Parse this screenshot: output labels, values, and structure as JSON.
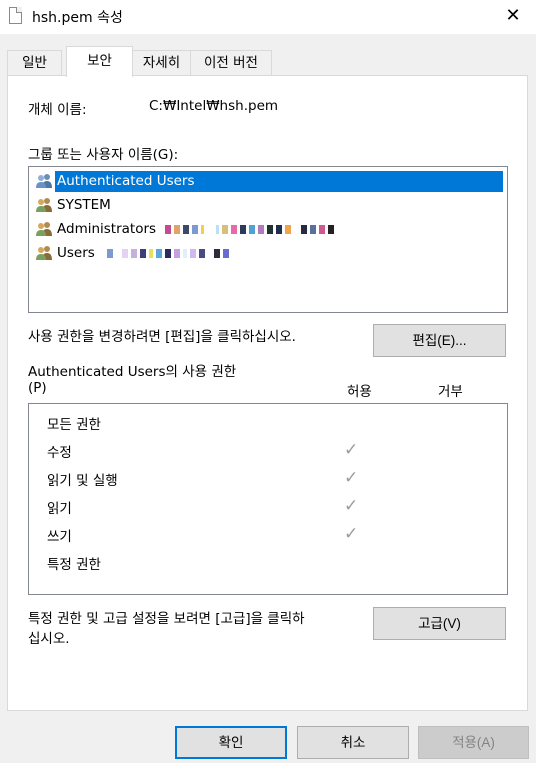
{
  "window": {
    "title": "hsh.pem 속성"
  },
  "tabs": [
    {
      "label": "일반"
    },
    {
      "label": "보안"
    },
    {
      "label": "자세히"
    },
    {
      "label": "이전 버전"
    }
  ],
  "security": {
    "object_name_label": "개체 이름:",
    "object_name_value": "C:₩Intel₩hsh.pem",
    "groups_label": "그룹 또는 사용자 이름(G):",
    "principals": [
      {
        "name": "Authenticated Users",
        "selected": true
      },
      {
        "name": "SYSTEM",
        "selected": false
      },
      {
        "name": "Administrators",
        "selected": false
      },
      {
        "name": "Users",
        "selected": false
      }
    ],
    "edit_hint": "사용 권한을 변경하려면 [편집]을 클릭하십시오.",
    "edit_button": "편집(E)...",
    "permissions_for_line1": "Authenticated Users의 사용 권한",
    "permissions_for_line2": "(P)",
    "allow_header": "허용",
    "deny_header": "거부",
    "permissions": [
      {
        "name": "모든 권한",
        "allow": false
      },
      {
        "name": "수정",
        "allow": true
      },
      {
        "name": "읽기 및 실행",
        "allow": true
      },
      {
        "name": "읽기",
        "allow": true
      },
      {
        "name": "쓰기",
        "allow": true
      },
      {
        "name": "특정 권한",
        "allow": false
      }
    ],
    "check_glyph": "✓",
    "advanced_hint_line1": "특정 권한 및 고급 설정을 보려면 [고급]을 클릭하",
    "advanced_hint_line2": "십시오.",
    "advanced_button": "고급(V)"
  },
  "footer": {
    "ok_button": "확인",
    "cancel_button": "취소",
    "apply_button": "적용(A)"
  },
  "colors": {
    "selection": "#0078d7",
    "checkmark": "#9b9b9b"
  }
}
